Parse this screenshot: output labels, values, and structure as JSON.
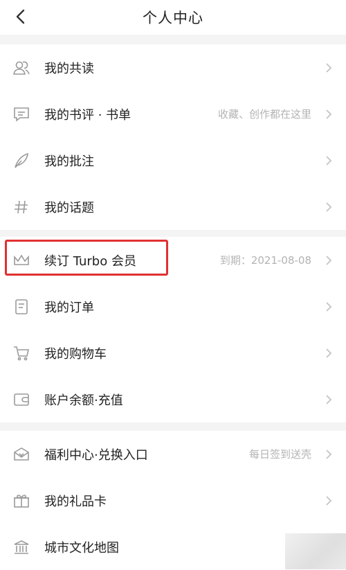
{
  "header": {
    "title": "个人中心"
  },
  "groups": [
    {
      "items": [
        {
          "label": "我的共读",
          "hint": ""
        },
        {
          "label": "我的书评 · 书单",
          "hint": "收藏、创作都在这里"
        },
        {
          "label": "我的批注",
          "hint": ""
        },
        {
          "label": "我的话题",
          "hint": ""
        }
      ]
    },
    {
      "items": [
        {
          "label": "续订 Turbo 会员",
          "hint": "到期：2021-08-08"
        },
        {
          "label": "我的订单",
          "hint": ""
        },
        {
          "label": "我的购物车",
          "hint": ""
        },
        {
          "label": "账户余额·充值",
          "hint": ""
        }
      ]
    },
    {
      "items": [
        {
          "label": "福利中心·兑换入口",
          "hint": "每日签到送壳"
        },
        {
          "label": "我的礼品卡",
          "hint": ""
        },
        {
          "label": "城市文化地图",
          "hint": ""
        }
      ]
    }
  ],
  "icons": [
    "co-reading-icon",
    "comment-icon",
    "feather-pen-icon",
    "hashtag-icon",
    "crown-icon",
    "order-document-icon",
    "shopping-cart-icon",
    "wallet-icon",
    "gift-box-icon",
    "gift-card-icon",
    "museum-icon"
  ],
  "colors": {
    "highlight_border": "#e03131",
    "hint_text": "#b3b3b3",
    "icon_stroke": "#9a9a9a"
  }
}
